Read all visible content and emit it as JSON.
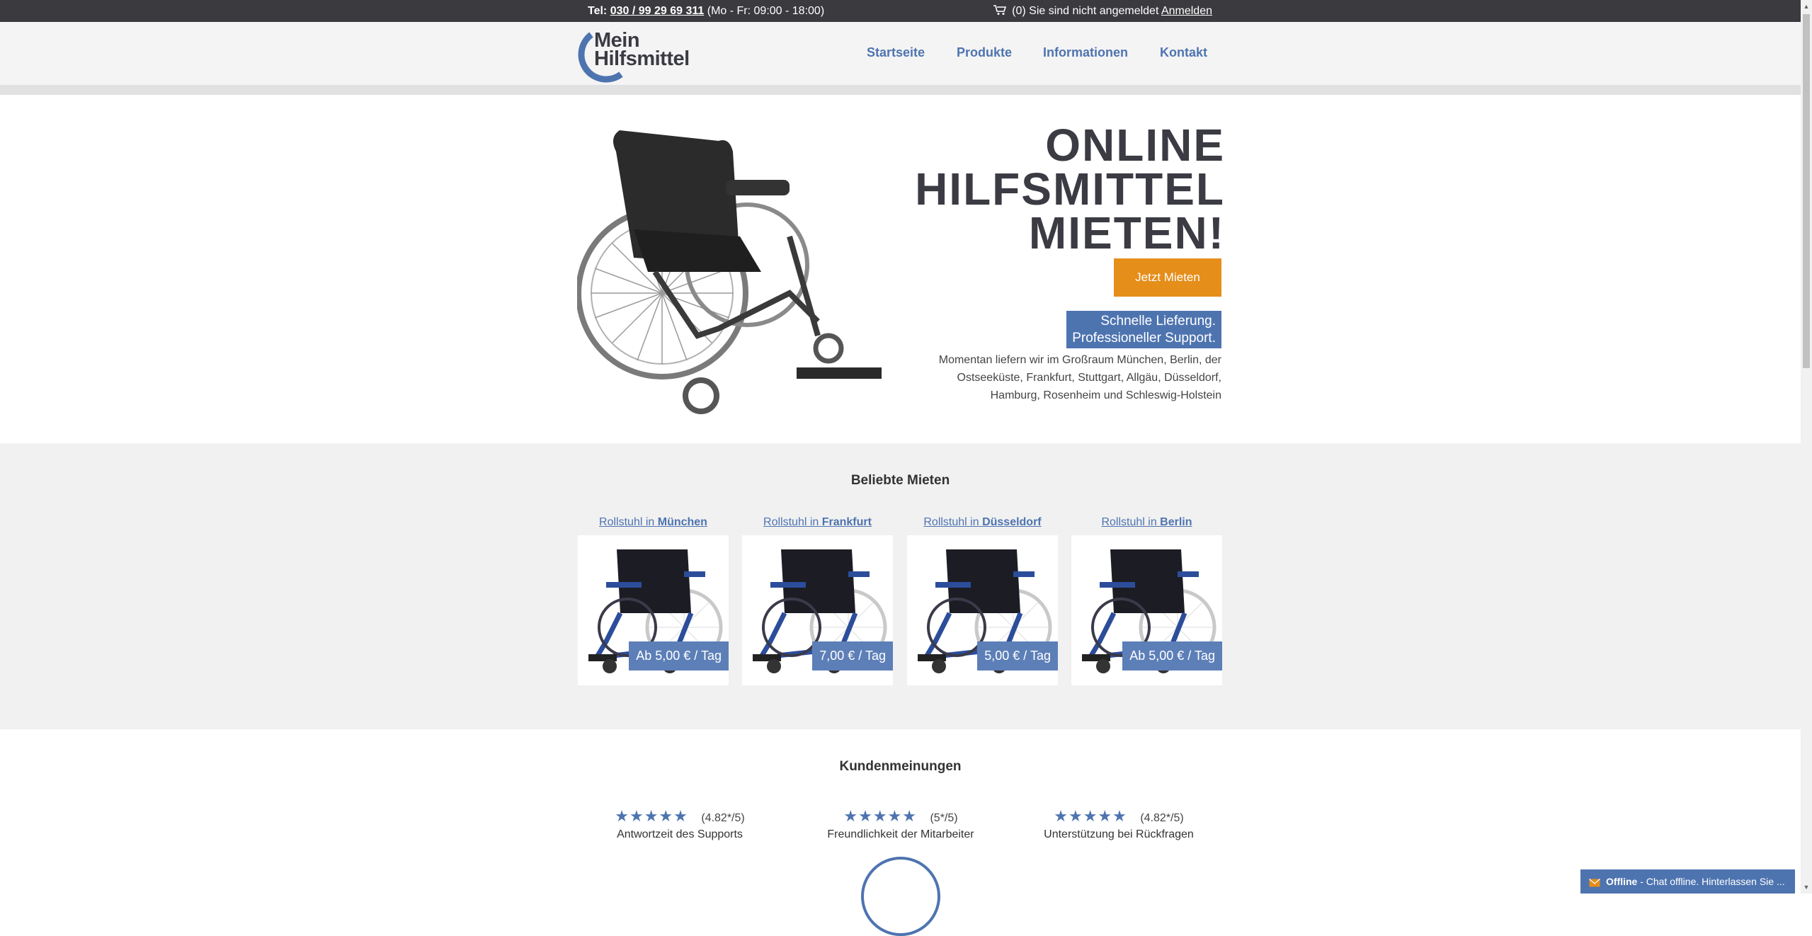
{
  "topbar": {
    "tel_label": "Tel:",
    "phone": "030 / 99 29 69 311",
    "hours": "(Mo - Fr: 09:00 - 18:00)",
    "cart_status": "(0) Sie sind nicht angemeldet",
    "login": "Anmelden"
  },
  "logo": {
    "line1": "Mein",
    "line2": "Hilfsmittel"
  },
  "nav": [
    "Startseite",
    "Produkte",
    "Informationen",
    "Kontakt"
  ],
  "hero": {
    "title_lines": [
      "ONLINE",
      "HILFSMITTEL",
      "MIETEN!"
    ],
    "cta": "Jetzt Mieten",
    "tagline_lines": [
      "Schnelle Lieferung.",
      "Professioneller Support."
    ],
    "delivery_text": "Momentan liefern wir im Großraum München, Berlin, der Ostseeküste, Frankfurt, Stuttgart, Allgäu, Düsseldorf, Hamburg, Rosenheim und Schleswig-Holstein"
  },
  "popular": {
    "title": "Beliebte Mieten",
    "items": [
      {
        "prefix": "Rollstuhl in ",
        "city": "München",
        "price": "Ab 5,00 € / Tag"
      },
      {
        "prefix": "Rollstuhl in ",
        "city": "Frankfurt",
        "price": "7,00 € / Tag"
      },
      {
        "prefix": "Rollstuhl in ",
        "city": "Düsseldorf",
        "price": "5,00 € / Tag"
      },
      {
        "prefix": "Rollstuhl in ",
        "city": "Berlin",
        "price": "Ab 5,00 € / Tag"
      }
    ]
  },
  "reviews": {
    "title": "Kundenmeinungen",
    "items": [
      {
        "stars": "★★★★★",
        "score": "(4.82*/5)",
        "label": "Antwortzeit des Supports"
      },
      {
        "stars": "★★★★★",
        "score": "(5*/5)",
        "label": "Freundlichkeit der Mitarbeiter"
      },
      {
        "stars": "★★★★★",
        "score": "(4.82*/5)",
        "label": "Unterstützung bei Rückfragen"
      }
    ]
  },
  "chat": {
    "status": "Offline",
    "message": " - Chat offline. Hinterlassen Sie ..."
  },
  "colors": {
    "accent": "#4e74b0",
    "cta": "#e58e1a",
    "topbar": "#3a3a3f",
    "heading": "#3b3b44"
  }
}
